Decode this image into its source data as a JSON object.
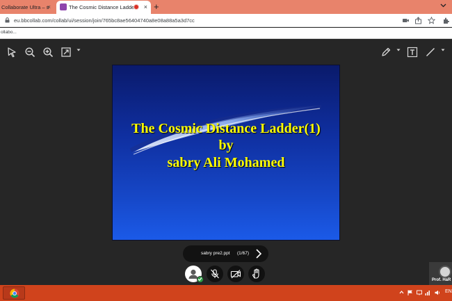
{
  "browser": {
    "tabs": [
      {
        "title": "Collaborate Ultra – s",
        "active": false
      },
      {
        "title": "The Cosmic Distance Ladde",
        "active": true,
        "recording": true
      }
    ],
    "new_tab_symbol": "+",
    "close_symbol": "×",
    "url": "eu.bbcollab.com/collab/ui/session/join/765bc8ae56404740a8e08a88a5a3d7cc",
    "bookmark": "ollabo..."
  },
  "toolbar": {
    "left_tools": [
      "pointer-icon",
      "zoom-out-icon",
      "zoom-in-icon",
      "fit-screen-icon"
    ],
    "right_tools": [
      "pen-icon",
      "text-tool-icon",
      "line-tool-icon"
    ]
  },
  "slide": {
    "line1": "The Cosmic Distance Ladder(1)",
    "line2": "by",
    "line3": "sabry Ali Mohamed",
    "text_color": "#ffff00"
  },
  "file_nav": {
    "filename": "sabry pre2.ppt",
    "page_count": "(1/67)"
  },
  "controls": [
    "avatar",
    "mic-off-icon",
    "camera-off-icon",
    "raise-hand-icon"
  ],
  "participant": {
    "name": "Prof. HaR"
  },
  "taskbar": {
    "tray_language": "EN"
  },
  "colors": {
    "tabbar": "#e8836b",
    "taskbar": "#d0431c",
    "app_background": "#262626",
    "status_green": "#2e9e45"
  }
}
